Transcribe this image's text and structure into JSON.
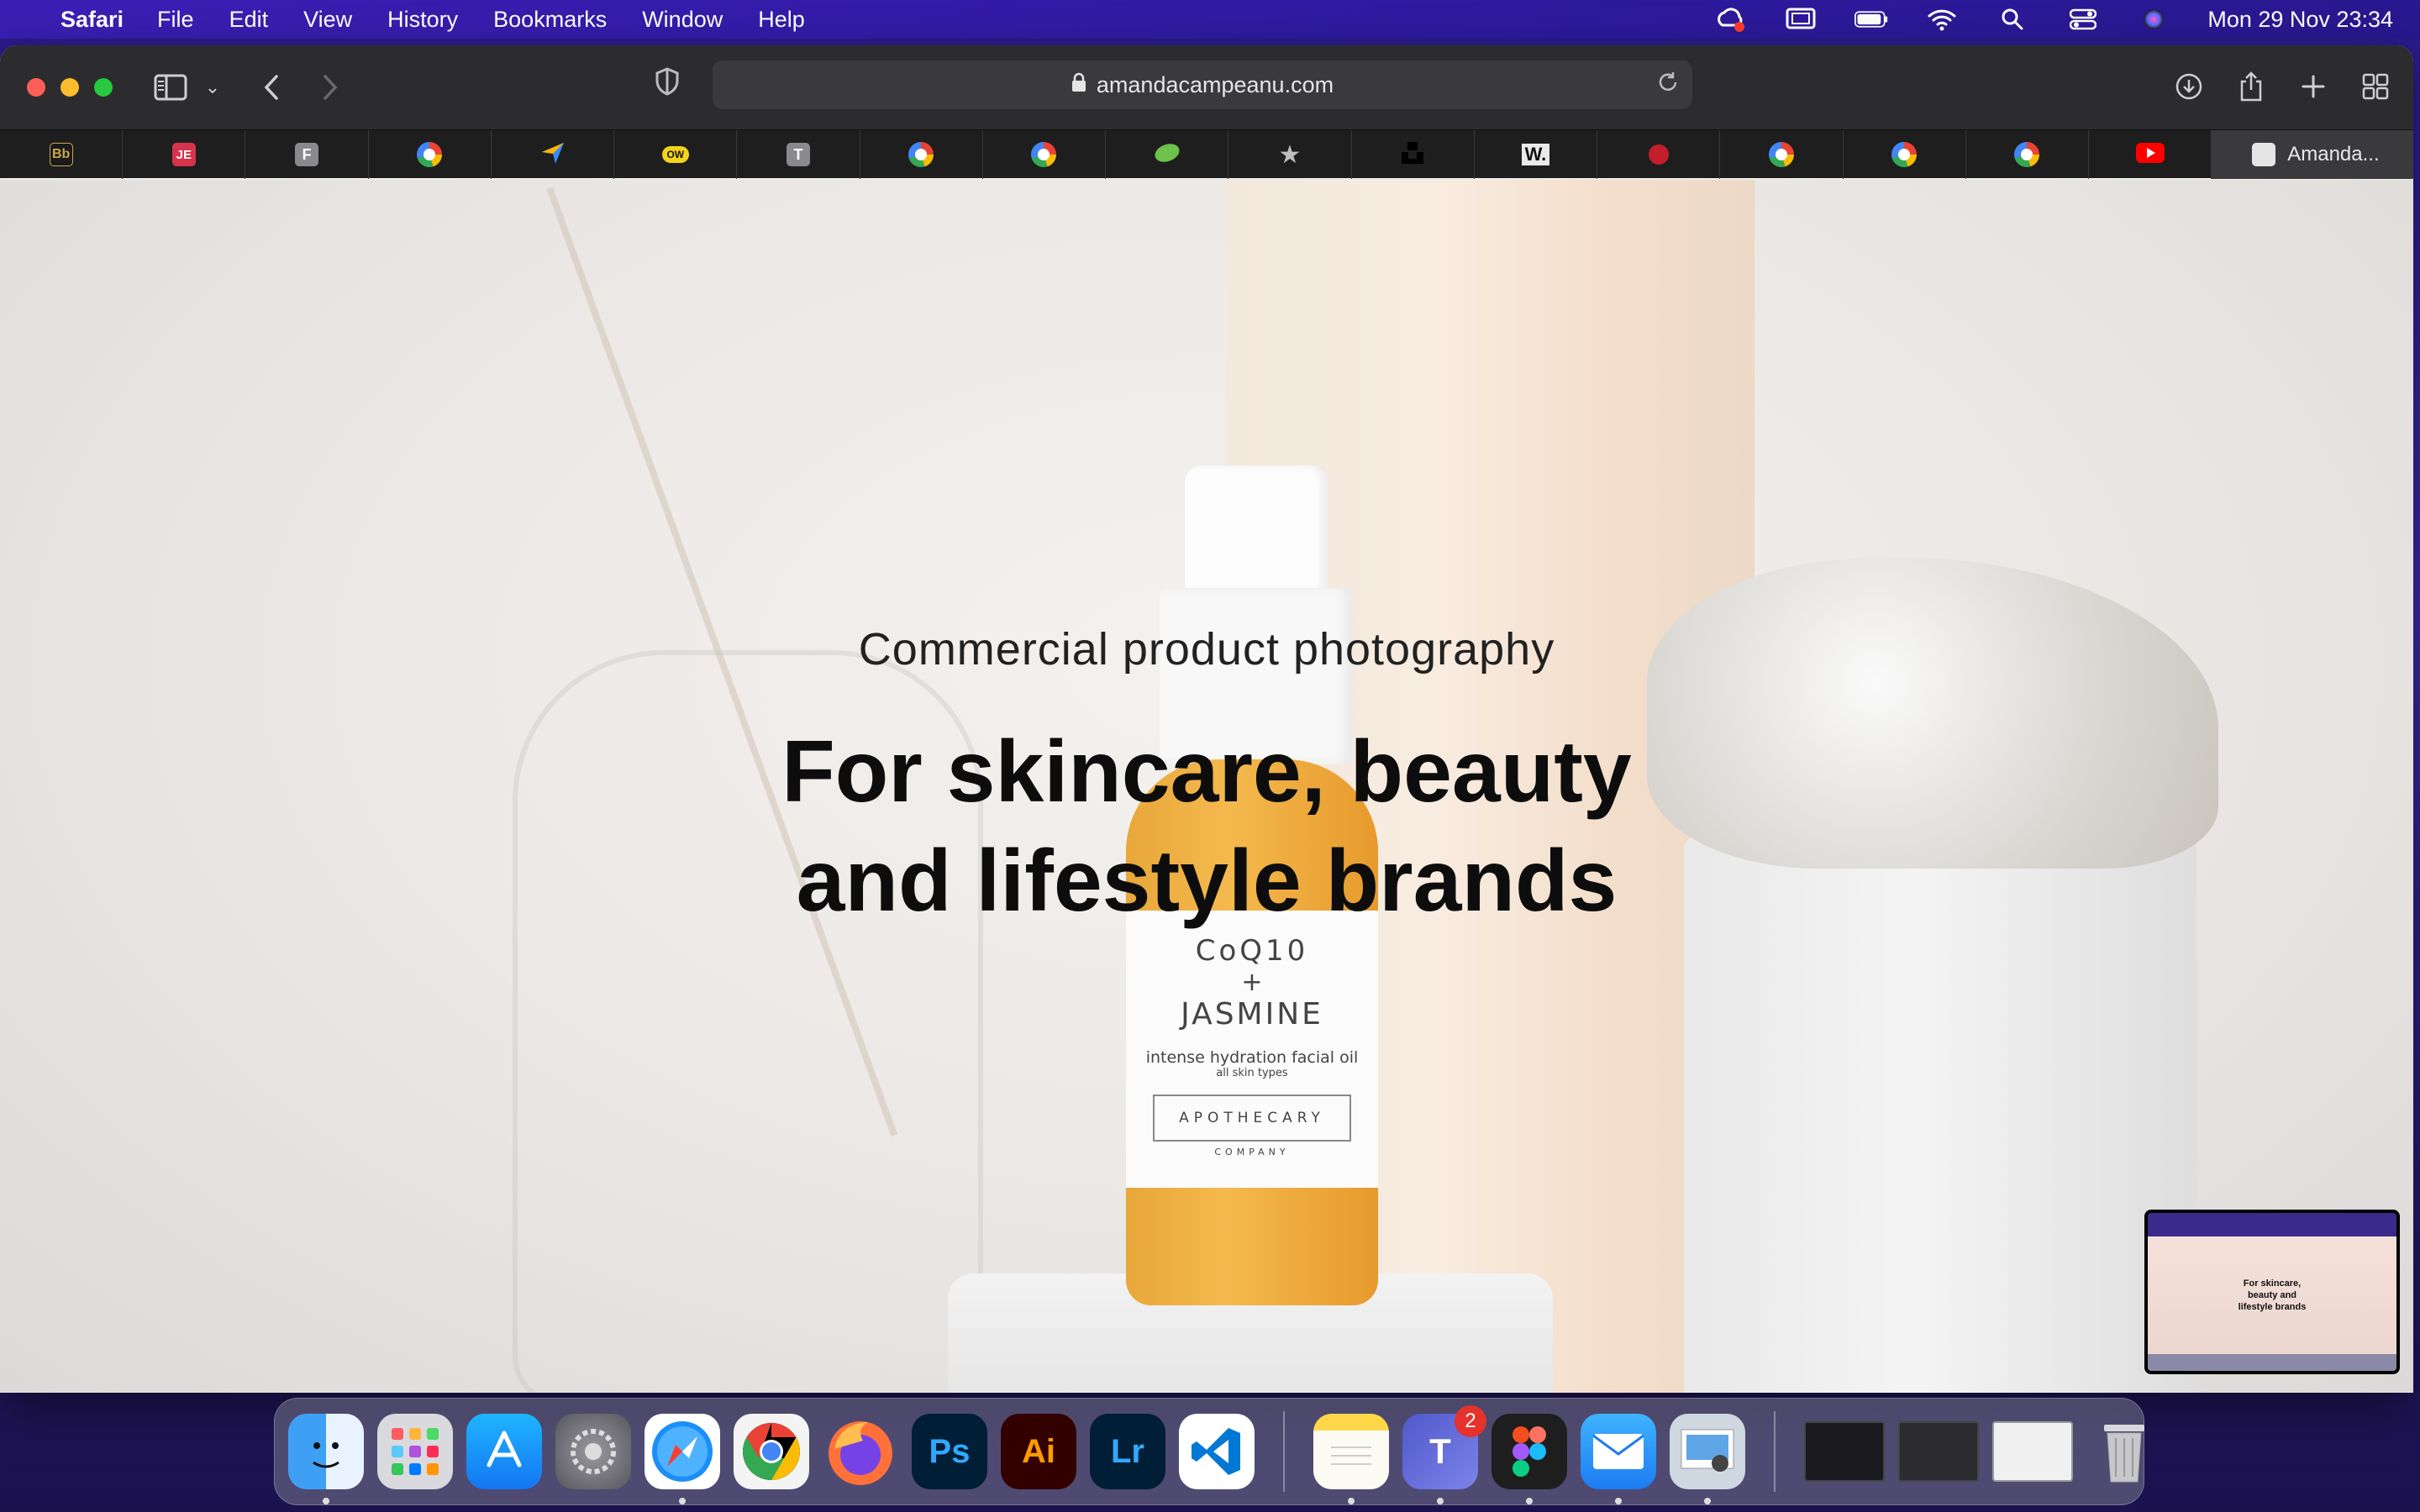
{
  "menubar": {
    "app": "Safari",
    "items": [
      "File",
      "Edit",
      "View",
      "History",
      "Bookmarks",
      "Window",
      "Help"
    ],
    "datetime": "Mon 29 Nov  23:34"
  },
  "browser": {
    "url": "amandacampeanu.com",
    "active_tab": "Amanda...",
    "tabs": [
      "Bb",
      "JE",
      "F",
      "G",
      "arrow",
      "OW",
      "T",
      "G",
      "G",
      "leaf",
      "★",
      "unsplash",
      "W.",
      "red-dot",
      "G",
      "G",
      "G",
      "youtube"
    ]
  },
  "hero": {
    "subtitle": "Commercial product photography",
    "title_line1": "For skincare, beauty",
    "title_line2": "and lifestyle brands"
  },
  "product": {
    "line1": "CoQ10",
    "line2": "+",
    "line3": "JASMINE",
    "line4": "intense hydration facial oil",
    "line5": "all skin types",
    "brand": "APOTHECARY",
    "brand_sub": "COMPANY"
  },
  "thumbnail": {
    "text": "For skincare, beauty and lifestyle brands"
  },
  "dock": {
    "teams_badge": "2",
    "apps": [
      "Finder",
      "Launchpad",
      "App Store",
      "System Preferences",
      "Safari",
      "Chrome",
      "Firefox",
      "Ps",
      "Ai",
      "Lr",
      "VS Code",
      "Notes",
      "Teams",
      "Figma",
      "Mail",
      "Preview"
    ]
  }
}
